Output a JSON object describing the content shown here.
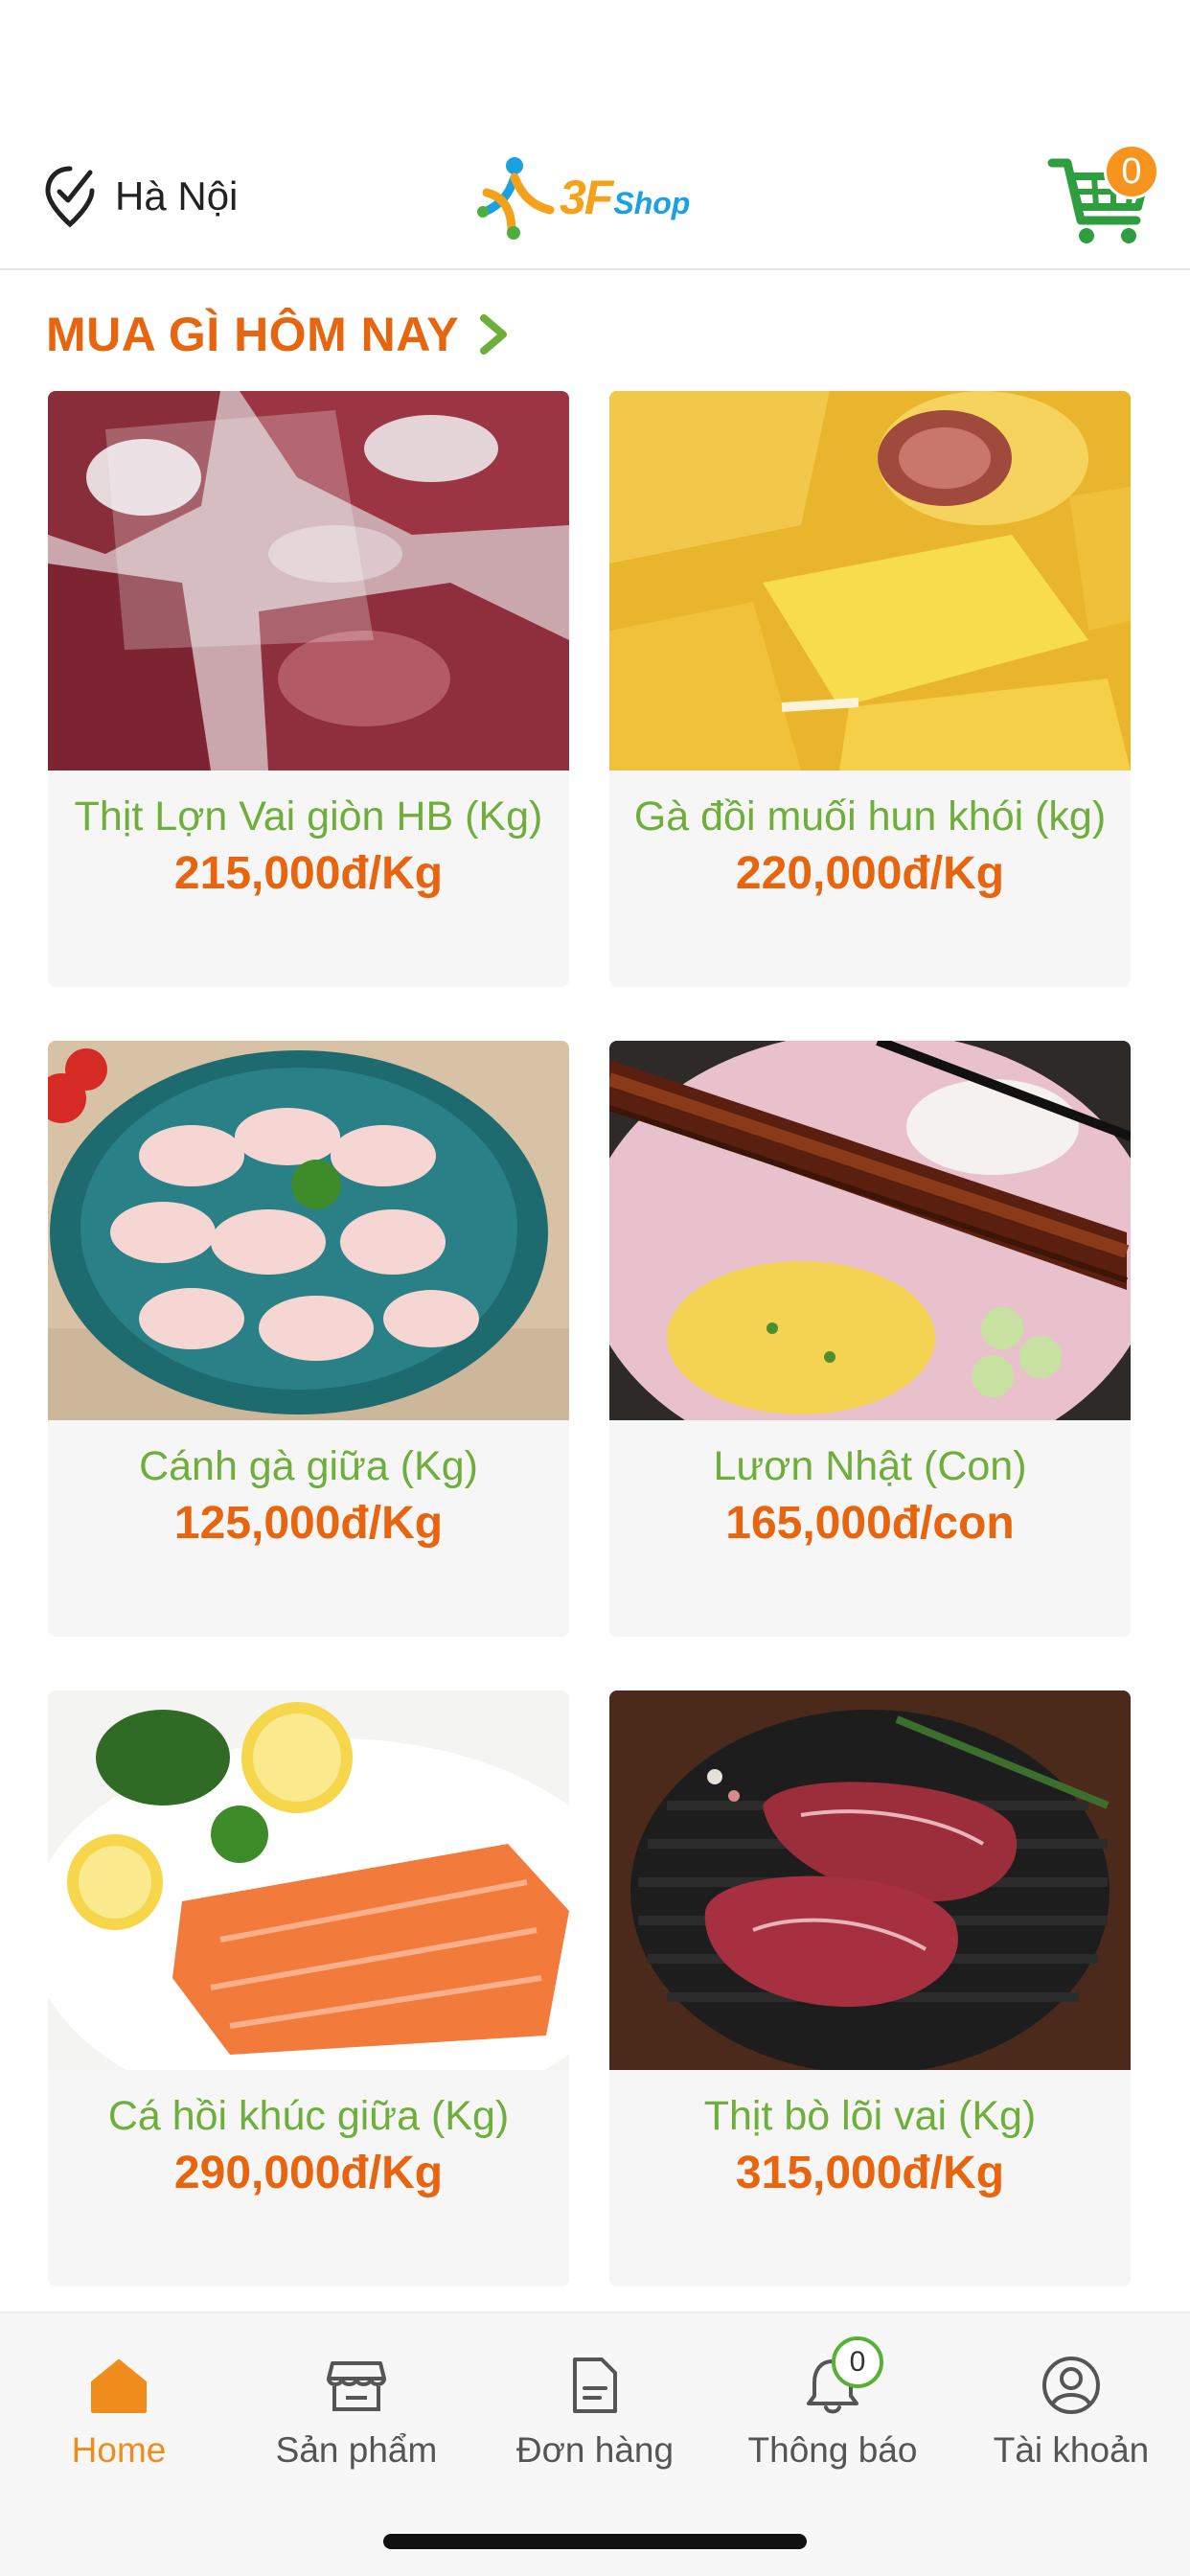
{
  "header": {
    "location": "Hà Nội",
    "logo_text_3f": "3F",
    "logo_text_shop": "Shop",
    "cart_count": "0",
    "location_icon": "location-pin-check-icon",
    "cart_icon": "shopping-cart-icon"
  },
  "section": {
    "title": "MUA GÌ HÔM NAY"
  },
  "products": [
    {
      "name": "Thịt Lợn Vai giòn HB (Kg)",
      "price": "215,000đ/Kg"
    },
    {
      "name": "Gà đồi muối hun khói (kg)",
      "price": "220,000đ/Kg"
    },
    {
      "name": "Cánh gà giữa (Kg)",
      "price": "125,000đ/Kg"
    },
    {
      "name": "Lươn Nhật (Con)",
      "price": "165,000đ/con"
    },
    {
      "name": "Cá hồi khúc giữa (Kg)",
      "price": "290,000đ/Kg"
    },
    {
      "name": "Thịt bò lõi vai (Kg)",
      "price": "315,000đ/Kg"
    }
  ],
  "nav": {
    "home": "Home",
    "products": "Sản phẩm",
    "orders": "Đơn hàng",
    "notifications": "Thông báo",
    "account": "Tài khoản",
    "notification_count": "0"
  },
  "colors": {
    "accent_orange": "#e8650f",
    "nav_active": "#f08c1c",
    "product_name_green": "#6fae3a",
    "cart_green": "#2e9e3f"
  }
}
